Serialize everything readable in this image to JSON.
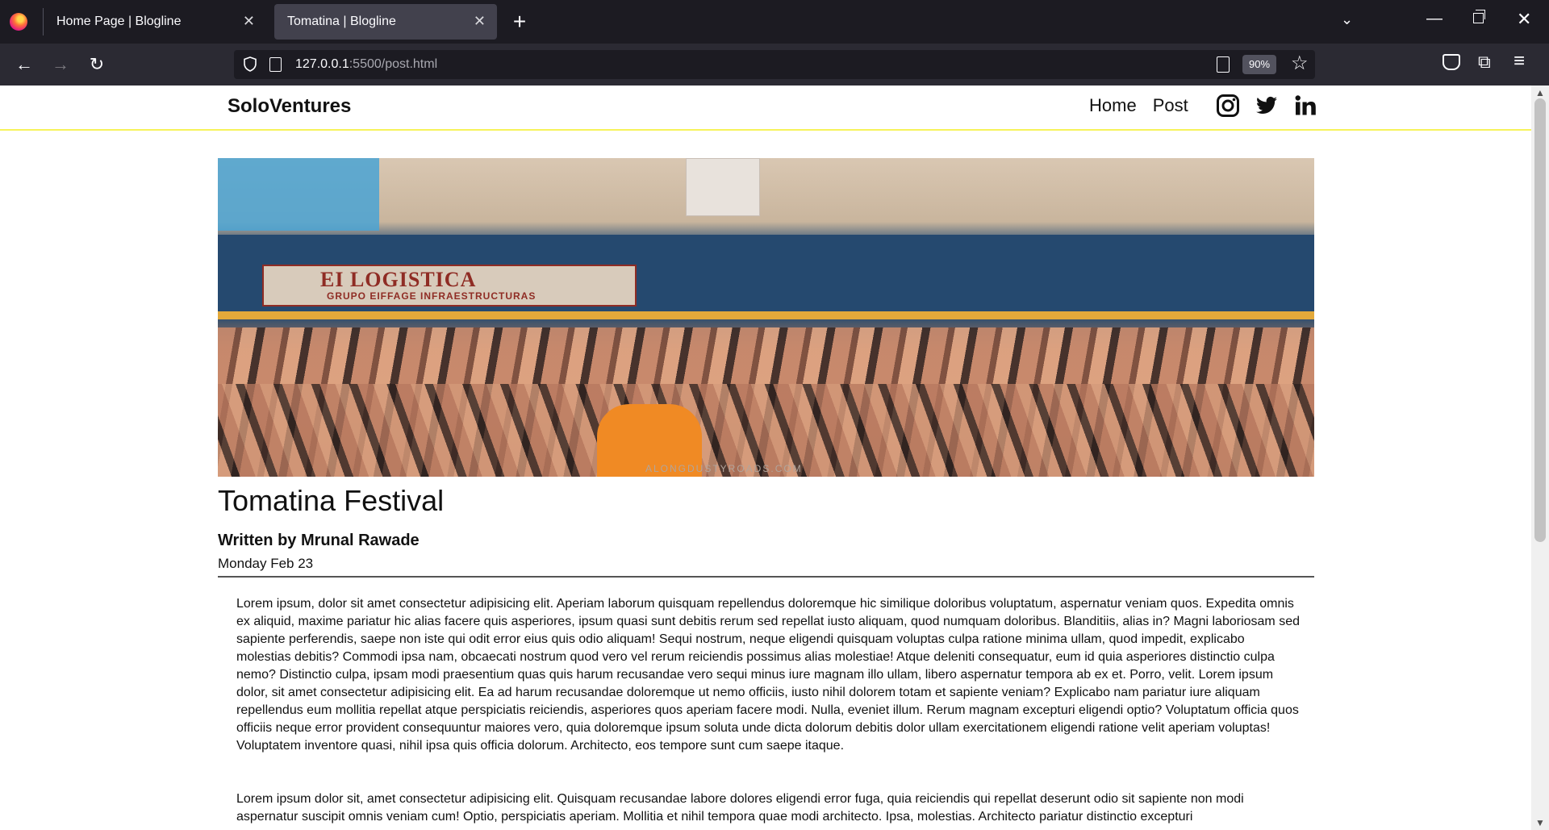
{
  "browser": {
    "tabs": [
      {
        "label": "Home Page | Blogline",
        "active": false
      },
      {
        "label": "Tomatina | Blogline",
        "active": true
      }
    ],
    "url_host": "127.0.0.1",
    "url_path": ":5500/post.html",
    "zoom": "90%"
  },
  "site": {
    "brand": "SoloVentures",
    "nav": [
      "Home",
      "Post"
    ],
    "social_icons": [
      "instagram-icon",
      "twitter-icon",
      "linkedin-icon"
    ],
    "accent_color": "#f7f35a"
  },
  "hero": {
    "sign_main": "EI LOGISTICA",
    "sign_sub": "GRUPO EIFFAGE INFRAESTRUCTURAS",
    "watermark": "ALONGDUSTYROADS.COM"
  },
  "post": {
    "title": "Tomatina Festival",
    "author": "Written by Mrunal Rawade",
    "date": "Monday Feb 23",
    "paragraphs": [
      "Lorem ipsum, dolor sit amet consectetur adipisicing elit. Aperiam laborum quisquam repellendus doloremque hic similique doloribus voluptatum, aspernatur veniam quos. Expedita omnis ex aliquid, maxime pariatur hic alias facere quis asperiores, ipsum quasi sunt debitis rerum sed repellat iusto aliquam, quod numquam doloribus. Blanditiis, alias in? Magni laboriosam sed sapiente perferendis, saepe non iste qui odit error eius quis odio aliquam! Sequi nostrum, neque eligendi quisquam voluptas culpa ratione minima ullam, quod impedit, explicabo molestias debitis? Commodi ipsa nam, obcaecati nostrum quod vero vel rerum reiciendis possimus alias molestiae! Atque deleniti consequatur, eum id quia asperiores distinctio culpa nemo? Distinctio culpa, ipsam modi praesentium quas quis harum recusandae vero sequi minus iure magnam illo ullam, libero aspernatur tempora ab ex et. Porro, velit. Lorem ipsum dolor, sit amet consectetur adipisicing elit. Ea ad harum recusandae doloremque ut nemo officiis, iusto nihil dolorem totam et sapiente veniam? Explicabo nam pariatur iure aliquam repellendus eum mollitia repellat atque perspiciatis reiciendis, asperiores quos aperiam facere modi. Nulla, eveniet illum. Rerum magnam excepturi eligendi optio? Voluptatum officia quos officiis neque error provident consequuntur maiores vero, quia doloremque ipsum soluta unde dicta dolorum debitis dolor ullam exercitationem eligendi ratione velit aperiam voluptas! Voluptatem inventore quasi, nihil ipsa quis officia dolorum. Architecto, eos tempore sunt cum saepe itaque.",
      "Lorem ipsum dolor sit, amet consectetur adipisicing elit. Quisquam recusandae labore dolores eligendi error fuga, quia reiciendis qui repellat deserunt odio sit sapiente non modi aspernatur suscipit omnis veniam cum! Optio, perspiciatis aperiam. Mollitia et nihil tempora quae modi architecto. Ipsa, molestias. Architecto pariatur distinctio excepturi"
    ]
  }
}
